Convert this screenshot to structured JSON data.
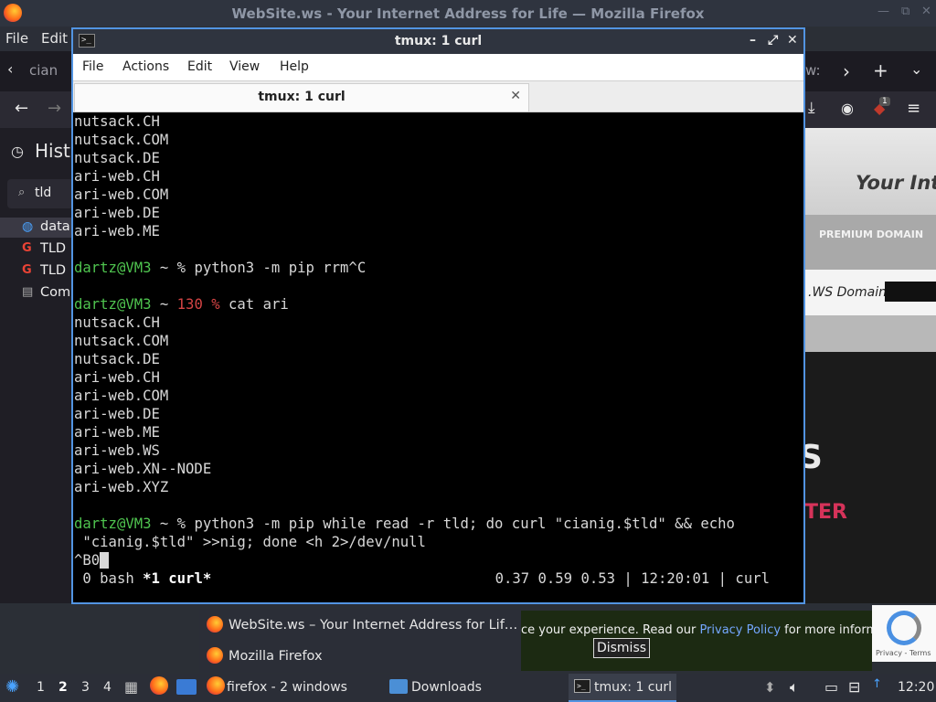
{
  "firefox": {
    "window_title": "WebSite.ws - Your Internet Address for Life — Mozilla Firefox",
    "menu": {
      "file": "File",
      "edit": "Edit"
    },
    "tab_partial": "cian",
    "tab_partial_right": "w:",
    "sidebar": {
      "title": "Hist",
      "search_value": "tld",
      "items": [
        "data",
        "TLD",
        "TLD",
        "Com"
      ]
    },
    "notification_count": "1",
    "content": {
      "headline": "Your Inte",
      "premium": "PREMIUM DOMAIN",
      "domain_label": ".WS Domain",
      "big_letter": "S",
      "red_text": "TER"
    },
    "cookie": {
      "text_before": "ce your experience. Read our ",
      "link": "Privacy Policy",
      "text_after": " for more information",
      "dismiss": "Dismiss"
    },
    "recaptcha": "Privacy - Terms"
  },
  "terminal": {
    "window_title": "tmux: 1 curl",
    "menu": [
      "File",
      "Actions",
      "Edit",
      "View",
      "Help"
    ],
    "tab_label": "tmux: 1 curl",
    "lines_top": [
      "nutsack.CH",
      "nutsack.COM",
      "nutsack.DE",
      "ari-web.CH",
      "ari-web.COM",
      "ari-web.DE",
      "ari-web.ME"
    ],
    "prompt_user": "dartz@VM3",
    "prompt1_rest": " ~ % python3 -m pip rrm^C",
    "prompt2_mid": " ~ ",
    "prompt2_code": "130 %",
    "prompt2_cmd": " cat ari",
    "lines_cat": [
      "nutsack.CH",
      "nutsack.COM",
      "nutsack.DE",
      "ari-web.CH",
      "ari-web.COM",
      "ari-web.DE",
      "ari-web.ME",
      "ari-web.WS",
      "ari-web.XN--NODE",
      "ari-web.XYZ"
    ],
    "prompt3_rest": " ~ % python3 -m pip while read -r tld; do curl \"cianig.$tld\" && echo",
    "prompt3_cont": " \"cianig.$tld\" >>nig; done <h 2>/dev/null",
    "input_line": "^B0",
    "status_left_a": " 0 bash ",
    "status_left_b": "*1 curl*",
    "status_right": "0.37 0.59 0.53 | 12:20:01 | curl"
  },
  "window_list": [
    "WebSite.ws – Your Internet Address for Lif…",
    "Mozilla Firefox"
  ],
  "taskbar": {
    "workspaces": [
      "1",
      "2",
      "3",
      "4"
    ],
    "active_workspace": "2",
    "tasks": [
      "firefox - 2 windows",
      "Downloads",
      "tmux: 1 curl"
    ],
    "clock": "12:20"
  }
}
